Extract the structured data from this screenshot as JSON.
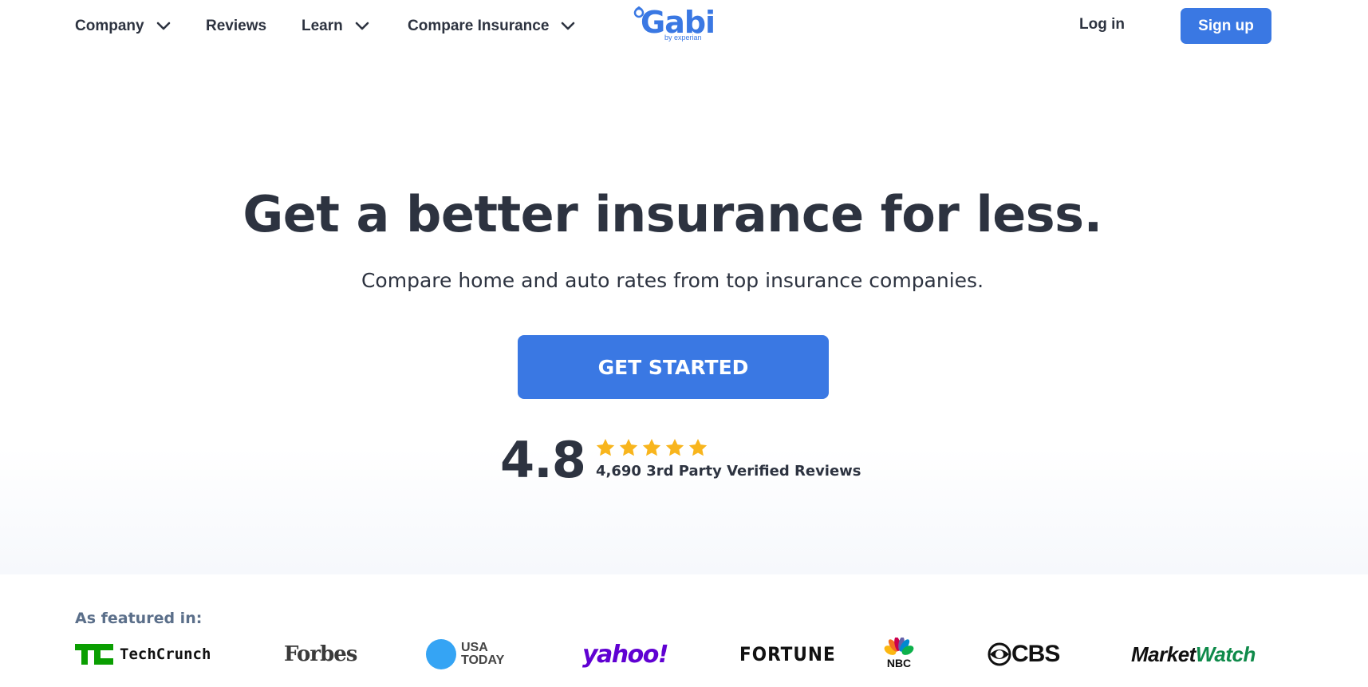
{
  "nav": {
    "items": [
      {
        "label": "Company",
        "has_dropdown": true
      },
      {
        "label": "Reviews",
        "has_dropdown": false
      },
      {
        "label": "Learn",
        "has_dropdown": true
      },
      {
        "label": "Compare Insurance",
        "has_dropdown": true
      }
    ],
    "logo": {
      "name": "Gabi",
      "sub": "by experian"
    },
    "login_label": "Log in",
    "signup_label": "Sign up"
  },
  "hero": {
    "headline": "Get a better insurance for less.",
    "subhead": "Compare home and auto rates from top insurance companies.",
    "cta_label": "GET STARTED",
    "rating": "4.8",
    "stars": 5,
    "reviews_text": "4,690 3rd Party Verified Reviews"
  },
  "featured": {
    "label": "As featured in:",
    "logos": [
      {
        "name": "TechCrunch",
        "icon": "techcrunch-logo"
      },
      {
        "name": "Forbes",
        "icon": "forbes-logo"
      },
      {
        "name": "USA TODAY",
        "line1": "USA",
        "line2": "TODAY",
        "icon": "usa-today-logo"
      },
      {
        "name": "yahoo!",
        "icon": "yahoo-logo"
      },
      {
        "name": "FORTUNE",
        "icon": "fortune-logo"
      },
      {
        "name": "NBC",
        "icon": "nbc-logo"
      },
      {
        "name": "CBS",
        "icon": "cbs-logo"
      },
      {
        "name": "MarketWatch",
        "part1": "Market",
        "part2": "Watch",
        "icon": "marketwatch-logo"
      }
    ]
  },
  "colors": {
    "brand": "#3a78e3",
    "text": "#2d3340",
    "star": "#f8b51d",
    "featured_label": "#5b6f8a"
  }
}
